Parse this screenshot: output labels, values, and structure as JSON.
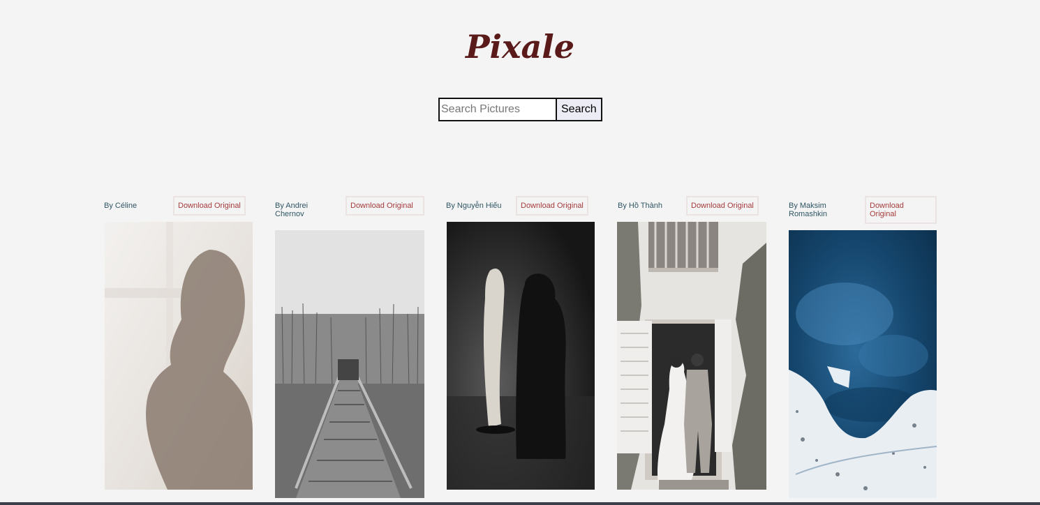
{
  "header": {
    "logo": "Pixale"
  },
  "search": {
    "placeholder": "Search Pictures",
    "value": "",
    "button_label": "Search"
  },
  "photos": [
    {
      "author": "By Céline",
      "download_label": "Download Original",
      "icon": "silhouette-photo"
    },
    {
      "author": "By Andrei Chernov",
      "download_label": "Download Original",
      "icon": "boardwalk-photo"
    },
    {
      "author": "By Nguyễn Hiếu",
      "download_label": "Download Original",
      "icon": "sculpture-photo"
    },
    {
      "author": "By Hồ Thành",
      "download_label": "Download Original",
      "icon": "wedding-photo"
    },
    {
      "author": "By Maksim Romashkin",
      "download_label": "Download Original",
      "icon": "aerial-ice-photo"
    }
  ],
  "colors": {
    "background": "#f4f4f4",
    "logo": "#5a1a1a",
    "author_text": "#2f5563",
    "download_text": "#a63a3a"
  }
}
